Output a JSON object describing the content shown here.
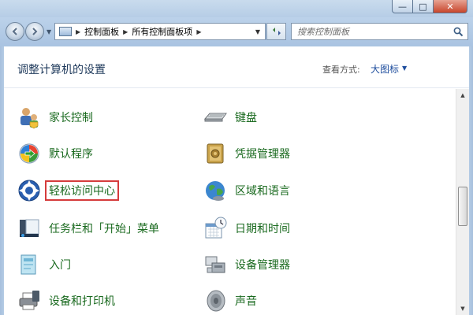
{
  "window": {
    "controls": {
      "minimize": "—",
      "maximize": "□",
      "close": "✕"
    }
  },
  "nav": {
    "breadcrumbs": [
      "控制面板",
      "所有控制面板项"
    ],
    "search_placeholder": "搜索控制面板"
  },
  "header": {
    "title": "调整计算机的设置",
    "view_by_label": "查看方式:",
    "view_by_value": "大图标"
  },
  "items_left": [
    {
      "label": "家长控制",
      "icon": "parental-controls-icon"
    },
    {
      "label": "默认程序",
      "icon": "default-programs-icon"
    },
    {
      "label": "轻松访问中心",
      "icon": "ease-of-access-icon",
      "highlighted": true
    },
    {
      "label": "任务栏和「开始」菜单",
      "icon": "taskbar-start-menu-icon"
    },
    {
      "label": "入门",
      "icon": "getting-started-icon"
    },
    {
      "label": "设备和打印机",
      "icon": "devices-printers-icon"
    }
  ],
  "items_right": [
    {
      "label": "键盘",
      "icon": "keyboard-icon"
    },
    {
      "label": "凭据管理器",
      "icon": "credential-manager-icon"
    },
    {
      "label": "区域和语言",
      "icon": "region-language-icon"
    },
    {
      "label": "日期和时间",
      "icon": "date-time-icon"
    },
    {
      "label": "设备管理器",
      "icon": "device-manager-icon"
    },
    {
      "label": "声音",
      "icon": "sound-icon"
    }
  ],
  "colors": {
    "item_text": "#1a6a1f",
    "highlight_border": "#d53c3c",
    "title_text": "#1e395b",
    "link_blue": "#1f4e9e"
  }
}
